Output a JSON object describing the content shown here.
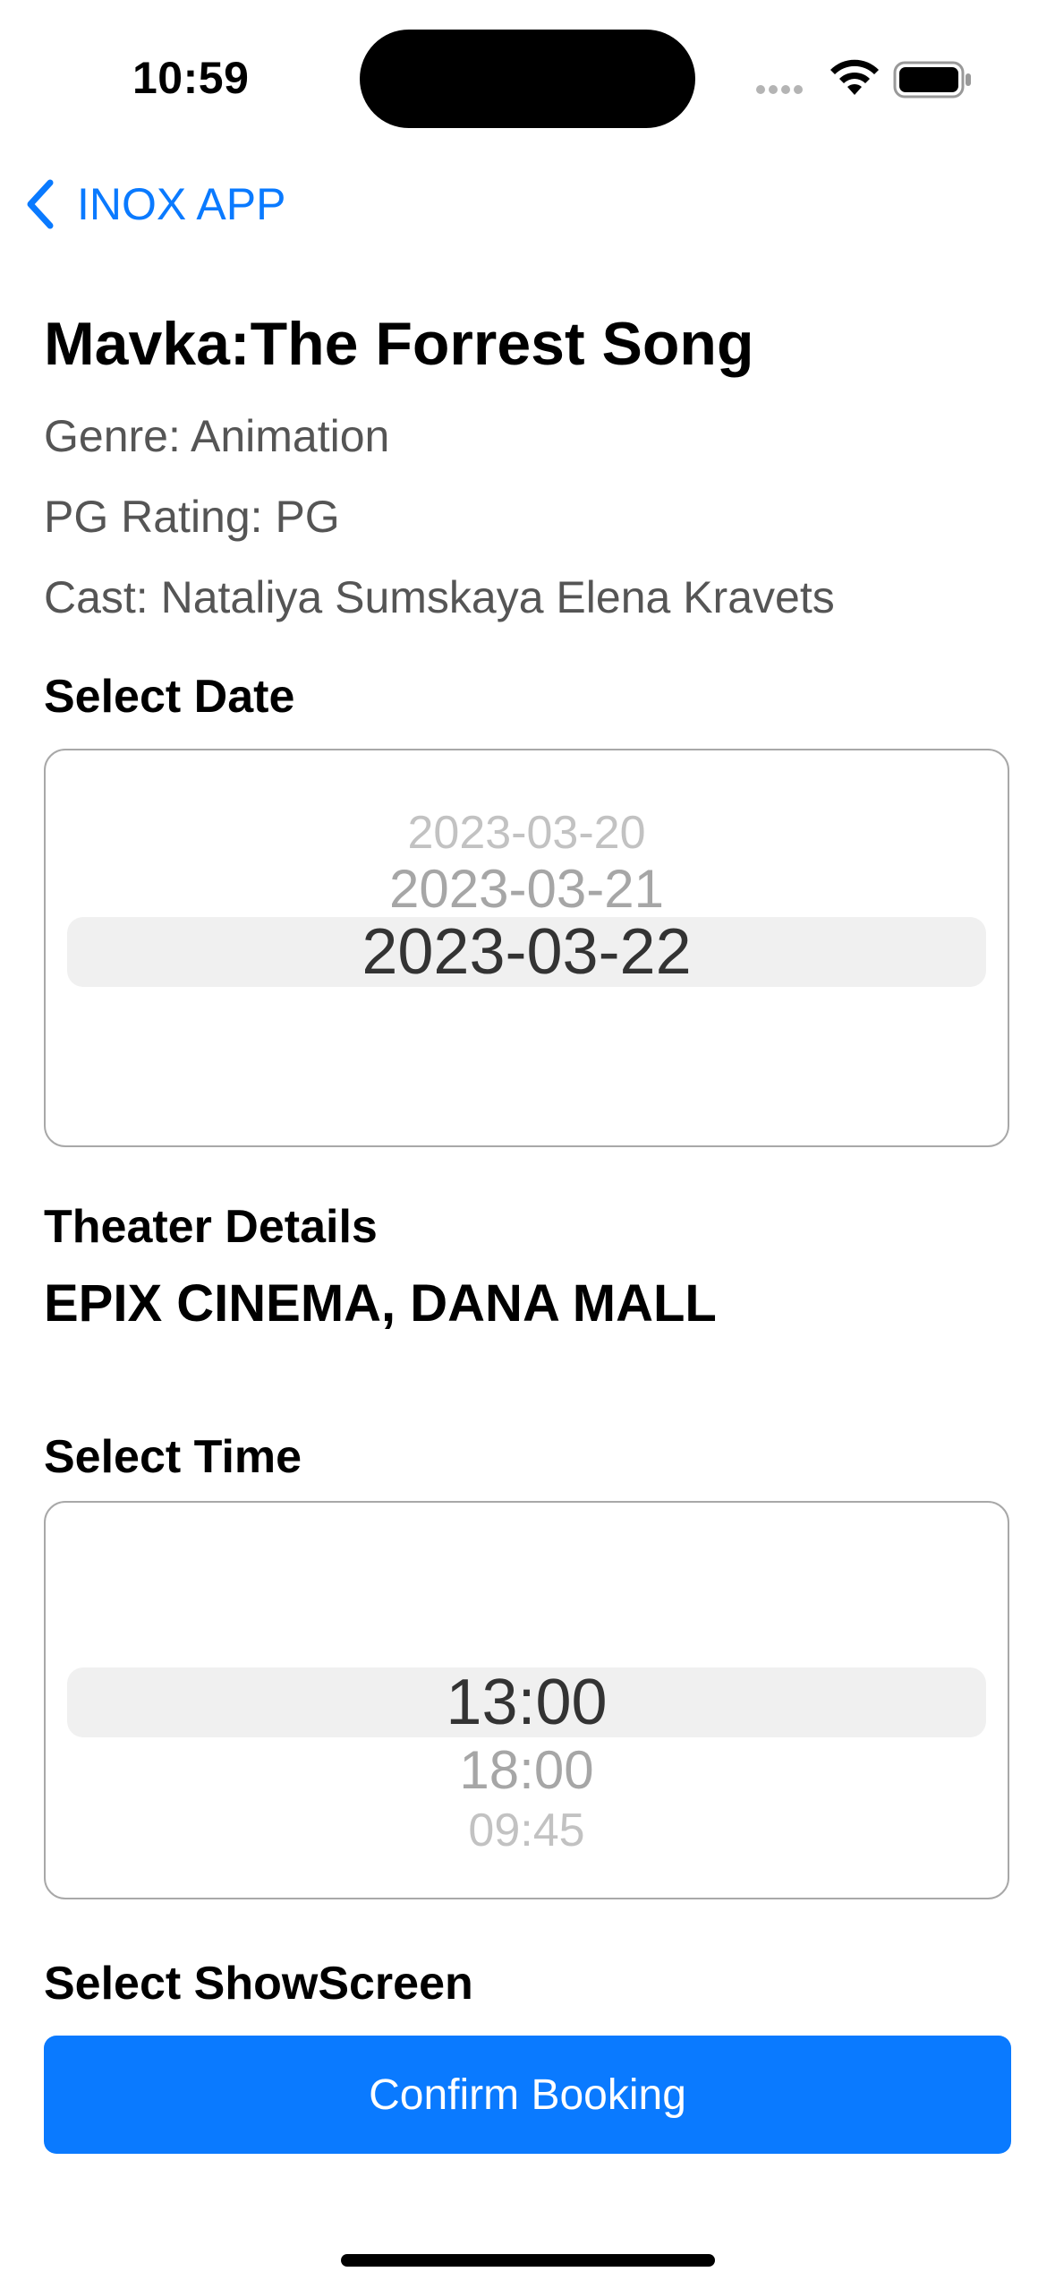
{
  "status_bar": {
    "time": "10:59"
  },
  "nav": {
    "back_label": "INOX APP"
  },
  "movie": {
    "title": "Mavka:The Forrest Song",
    "genre": "Genre: Animation",
    "rating": "PG Rating: PG",
    "cast": "Cast: Nataliya Sumskaya Elena Kravets"
  },
  "date_section": {
    "label": "Select Date",
    "options": [
      "2023-03-20",
      "2023-03-21",
      "2023-03-22"
    ],
    "selected": "2023-03-22"
  },
  "theater": {
    "label": "Theater Details",
    "name": "EPIX CINEMA, DANA MALL"
  },
  "time_section": {
    "label": "Select Time",
    "options": [
      "13:00",
      "18:00",
      "09:45"
    ],
    "selected": "13:00"
  },
  "screen_section": {
    "label": "Select ShowScreen"
  },
  "confirm_label": "Confirm Booking",
  "colors": {
    "accent": "#0a7aff",
    "secondary_text": "#555555"
  }
}
